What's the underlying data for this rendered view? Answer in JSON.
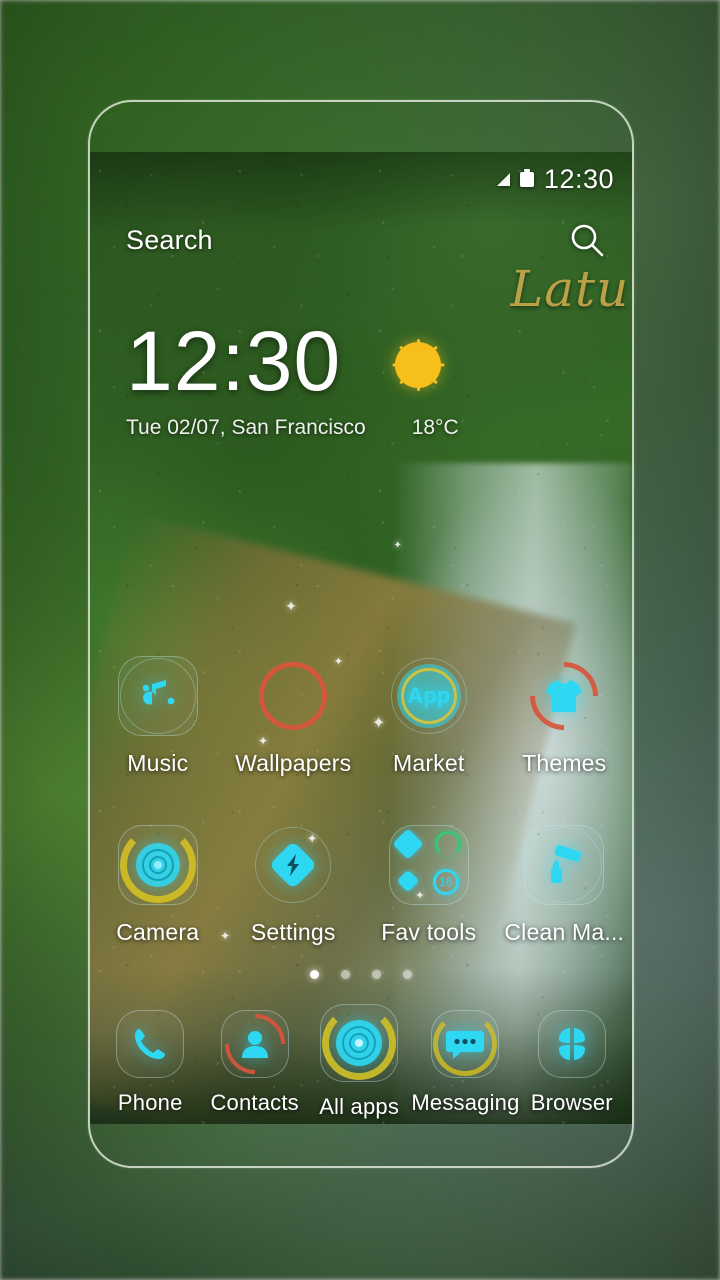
{
  "backdrop": {
    "description": "blurred green forest backdrop"
  },
  "device": {
    "frame": "phone-outline"
  },
  "statusbar": {
    "time": "12:30",
    "signal_icon": "signal-triangle-icon",
    "battery_icon": "battery-icon"
  },
  "search": {
    "label": "Search",
    "icon": "search-icon"
  },
  "watermark": {
    "text": "Latu"
  },
  "clock_widget": {
    "time": "12:30",
    "weather_icon": "sun-icon",
    "date_location": "Tue  02/07, San Francisco",
    "temperature": "18°C"
  },
  "home_grid": {
    "rows": [
      [
        {
          "label": "Music",
          "icon": "music-note-icon"
        },
        {
          "label": "Wallpapers",
          "icon": "wallpapers-icon"
        },
        {
          "label": "Market",
          "icon": "market-app-icon",
          "glyph_text": "App"
        },
        {
          "label": "Themes",
          "icon": "themes-tshirt-icon"
        }
      ],
      [
        {
          "label": "Camera",
          "icon": "camera-lens-icon"
        },
        {
          "label": "Settings",
          "icon": "settings-bolt-icon"
        },
        {
          "label": "Fav tools",
          "icon": "fav-tools-folder-icon",
          "badge": "16"
        },
        {
          "label": "Clean Ma...",
          "icon": "clean-master-roller-icon"
        }
      ]
    ]
  },
  "page_indicator": {
    "count": 4,
    "active_index": 0
  },
  "dock": {
    "items": [
      {
        "label": "Phone",
        "icon": "phone-handset-icon"
      },
      {
        "label": "Contacts",
        "icon": "contacts-person-icon"
      },
      {
        "label": "All apps",
        "icon": "all-apps-icon"
      },
      {
        "label": "Messaging",
        "icon": "messaging-bubble-icon"
      },
      {
        "label": "Browser",
        "icon": "browser-icon"
      }
    ]
  },
  "colors": {
    "accent_cyan": "#2fd8f2",
    "accent_orange": "#d9553c",
    "accent_yellow": "#d7c020",
    "sun_yellow": "#f6bf1c",
    "text_white": "#ffffff",
    "watermark_gold": "#c5a64a"
  }
}
